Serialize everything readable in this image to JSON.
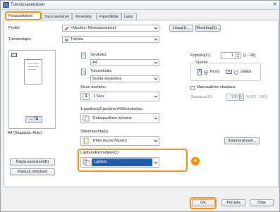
{
  "window": {
    "title": "Tulostusasetukset"
  },
  "tabs": [
    {
      "label": "Perusasetukset",
      "active": true
    },
    {
      "label": "Sivun asetukset"
    },
    {
      "label": "Viimeistely"
    },
    {
      "label": "Paperilähde"
    },
    {
      "label": "Laatu"
    }
  ],
  "profile": {
    "label": "Profiili:",
    "value": "<Muuttu> Oletusasetukset",
    "add_button": "Lisaa(1)...",
    "edit_button": "Muokkaa(2)..."
  },
  "output_method": {
    "label": "Tulostustapa:",
    "value": "Tulosta"
  },
  "preview": {
    "caption": "A4 [Skaalaus: Auto]"
  },
  "left_buttons": {
    "view_settings": "Näytä asetukset(B)",
    "restore_defaults": "Palauta oletukset"
  },
  "page_size": {
    "label": "Sivukoko:",
    "value": "A4"
  },
  "output_size": {
    "label": "Tulostekoko:",
    "value": "Sovita sivukokoa"
  },
  "copies": {
    "label": "Kopioita(C):",
    "value": "1",
    "range": "[1 - 99]"
  },
  "orientation": {
    "label": "Suunta",
    "portrait": "Pysty",
    "landscape": "Vaaka",
    "selected": "portrait"
  },
  "page_layout": {
    "label": "Sivun asettelu:",
    "number": "1",
    "value": "1 Sivu"
  },
  "manual_scaling": {
    "label": "Manuaalinen skaalaus",
    "scale_label": "Skaalaus(G):",
    "scale_value": "100",
    "scale_range": "% [25 - 200]"
  },
  "duplex": {
    "label": "1-puolinen/2-puolinen/Vihkotulostus:",
    "value": "Kaksipuolinen tulostus"
  },
  "binding": {
    "label": "Sidontakohta(0):",
    "value": "Pitkä reuna [Vasen]",
    "margin_button": "Sisämarginaali..."
  },
  "finishing": {
    "label": "Lajittelu/Ryhmittely(C):",
    "value": "Lajittelu",
    "callout": "a"
  },
  "footer": {
    "ok": "OK",
    "cancel": "Peruuta",
    "help": "Ohje"
  },
  "colors": {
    "accent": "#f39200",
    "selection": "#1a5fb4"
  }
}
